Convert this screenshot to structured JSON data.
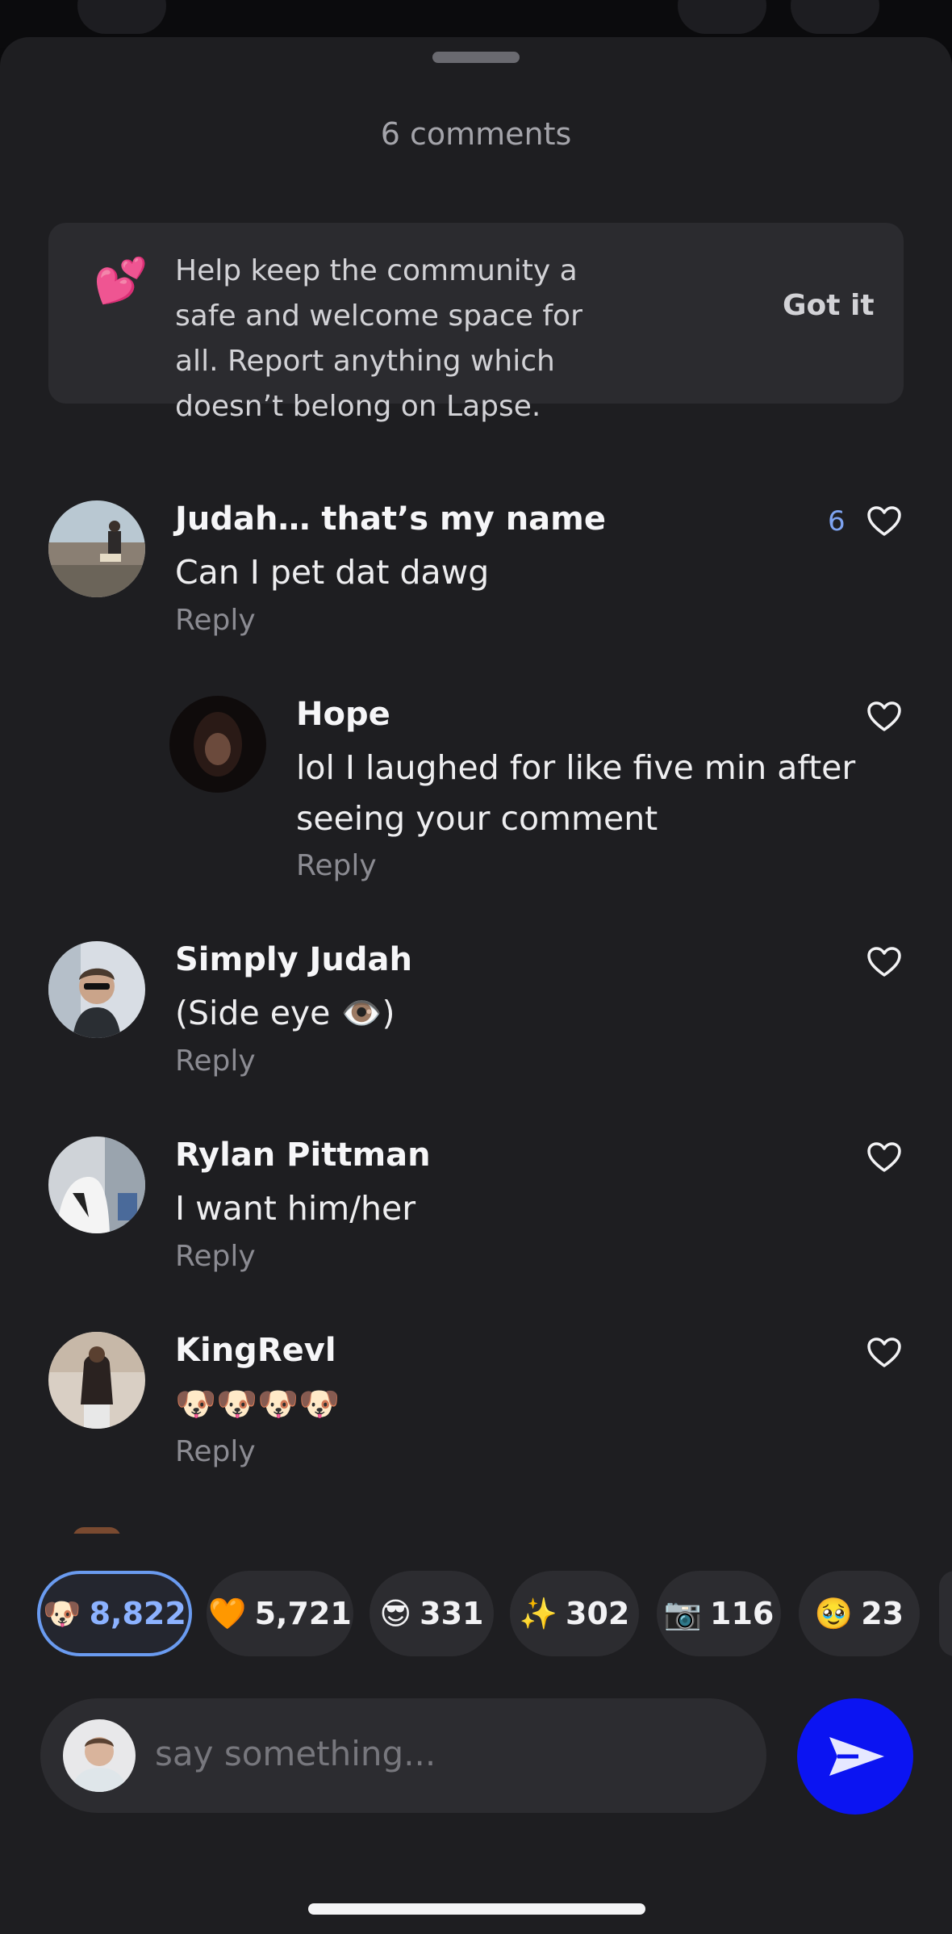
{
  "sheet": {
    "title": "6 comments"
  },
  "notice": {
    "icon": "💕",
    "text": "Help keep the community a safe and welcome space for all. Report anything which doesn’t belong on Lapse.",
    "button_label": "Got it"
  },
  "comments": [
    {
      "name": "Judah… that’s my name",
      "text": "Can I pet dat dawg",
      "reply_label": "Reply",
      "likes": "6"
    },
    {
      "name": "Hope",
      "text": "lol I laughed for like five min after seeing your comment",
      "reply_label": "Reply"
    },
    {
      "name": "Simply Judah",
      "text": "(Side eye 👁️)",
      "reply_label": "Reply"
    },
    {
      "name": "Rylan Pittman",
      "text": "I want him/her",
      "reply_label": "Reply"
    },
    {
      "name": "KingRevl",
      "text": "🐶🐶🐶🐶",
      "reply_label": "Reply"
    }
  ],
  "reactions": [
    {
      "emoji": "🐶",
      "count": "8,822",
      "selected": true
    },
    {
      "emoji": "🧡",
      "count": "5,721"
    },
    {
      "emoji": "😎",
      "count": "331"
    },
    {
      "emoji": "✨",
      "count": "302"
    },
    {
      "emoji": "📷",
      "count": "116"
    },
    {
      "emoji": "🥹",
      "count": "23"
    }
  ],
  "composer": {
    "placeholder": "say something..."
  },
  "colors": {
    "accent": "#0b14f2",
    "like_count": "#7ea3f0",
    "selected_reaction": "#6a9bf0"
  }
}
